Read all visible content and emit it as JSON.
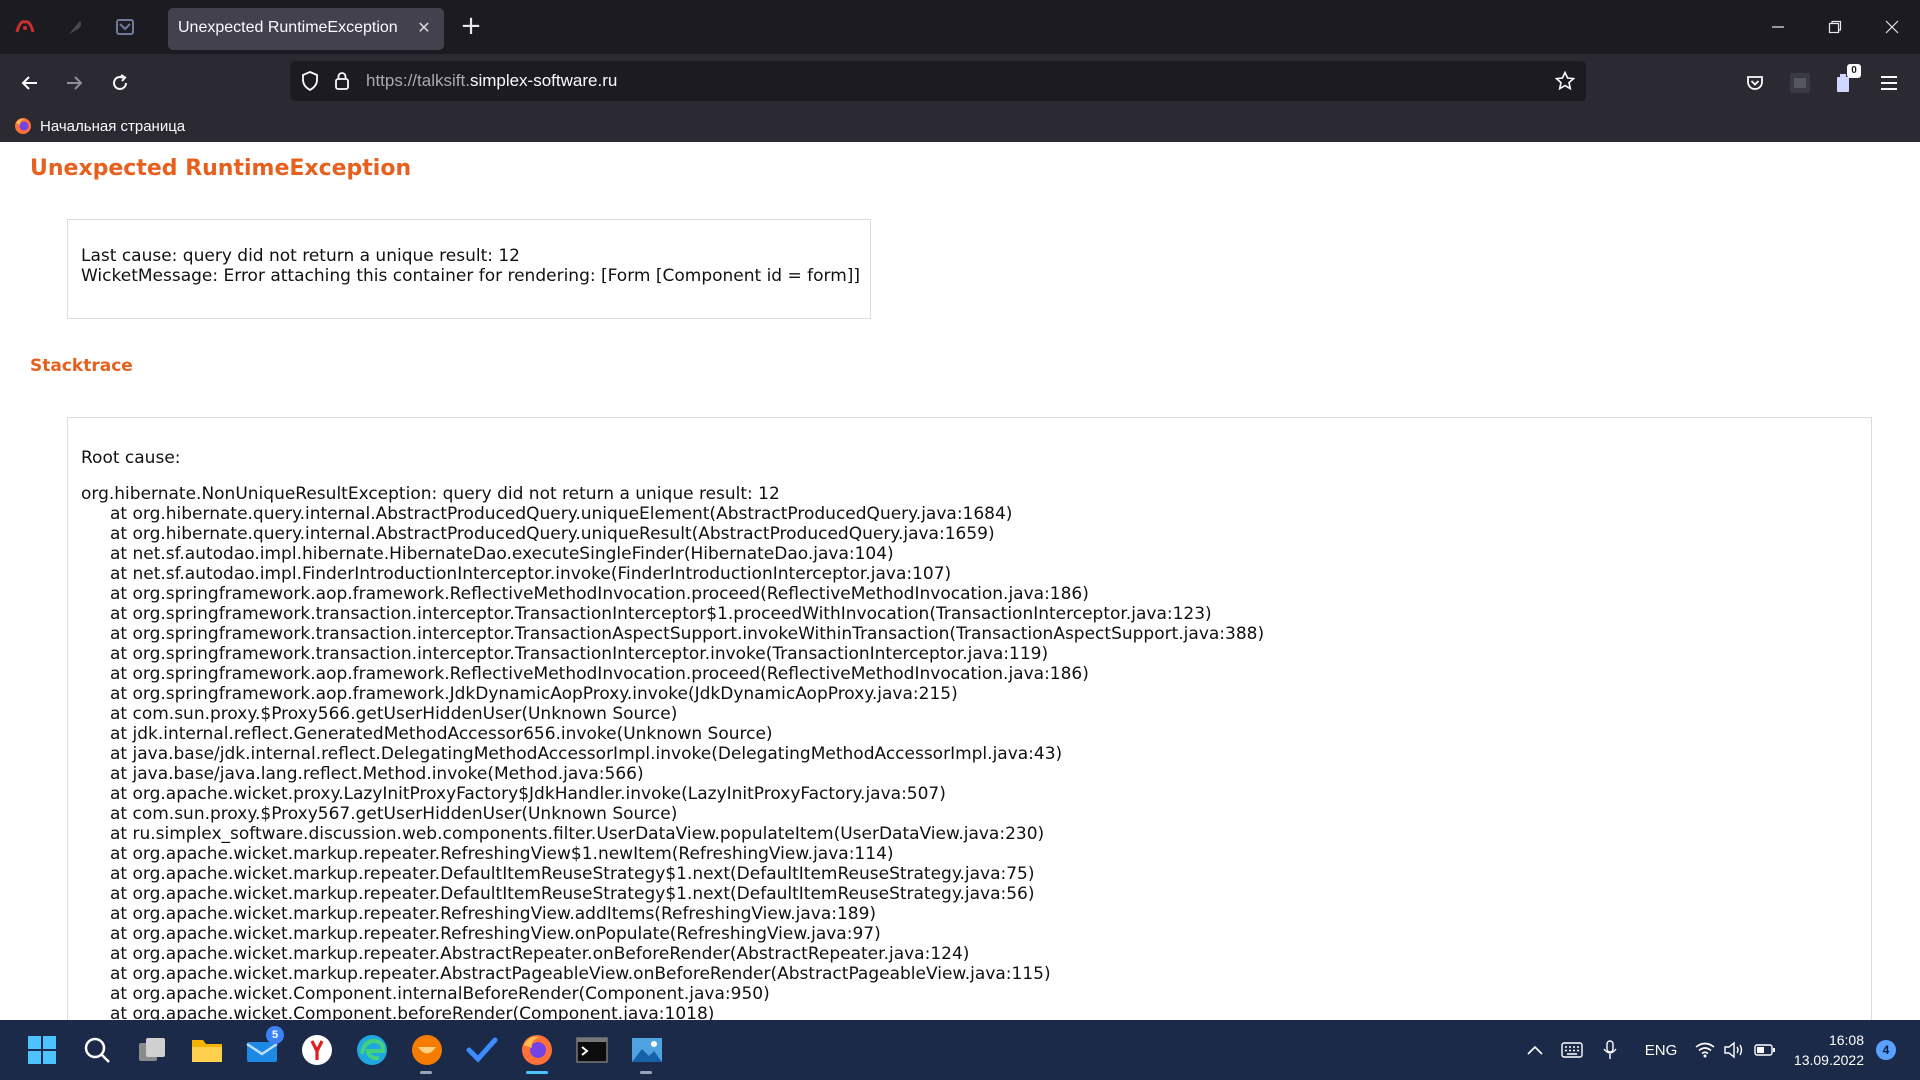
{
  "browser": {
    "tab": {
      "title": "Unexpected RuntimeException"
    },
    "url": {
      "scheme_subdomain": "https://talksift.",
      "domain": "simplex-software.ru"
    },
    "bookmarks": [
      {
        "label": "Начальная страница"
      }
    ],
    "extensions_badge": "0"
  },
  "page": {
    "title": "Unexpected RuntimeException",
    "cause_lines": [
      "Last cause: query did not return a unique result: 12",
      "WicketMessage: Error attaching this container for rendering: [Form [Component id = form]]"
    ],
    "stacktrace_heading": "Stacktrace",
    "root_cause_label": "Root cause:",
    "exception": "org.hibernate.NonUniqueResultException: query did not return a unique result: 12",
    "frames": [
      "at org.hibernate.query.internal.AbstractProducedQuery.uniqueElement(AbstractProducedQuery.java:1684)",
      "at org.hibernate.query.internal.AbstractProducedQuery.uniqueResult(AbstractProducedQuery.java:1659)",
      "at net.sf.autodao.impl.hibernate.HibernateDao.executeSingleFinder(HibernateDao.java:104)",
      "at net.sf.autodao.impl.FinderIntroductionInterceptor.invoke(FinderIntroductionInterceptor.java:107)",
      "at org.springframework.aop.framework.ReflectiveMethodInvocation.proceed(ReflectiveMethodInvocation.java:186)",
      "at org.springframework.transaction.interceptor.TransactionInterceptor$1.proceedWithInvocation(TransactionInterceptor.java:123)",
      "at org.springframework.transaction.interceptor.TransactionAspectSupport.invokeWithinTransaction(TransactionAspectSupport.java:388)",
      "at org.springframework.transaction.interceptor.TransactionInterceptor.invoke(TransactionInterceptor.java:119)",
      "at org.springframework.aop.framework.ReflectiveMethodInvocation.proceed(ReflectiveMethodInvocation.java:186)",
      "at org.springframework.aop.framework.JdkDynamicAopProxy.invoke(JdkDynamicAopProxy.java:215)",
      "at com.sun.proxy.$Proxy566.getUserHiddenUser(Unknown Source)",
      "at jdk.internal.reflect.GeneratedMethodAccessor656.invoke(Unknown Source)",
      "at java.base/jdk.internal.reflect.DelegatingMethodAccessorImpl.invoke(DelegatingMethodAccessorImpl.java:43)",
      "at java.base/java.lang.reflect.Method.invoke(Method.java:566)",
      "at org.apache.wicket.proxy.LazyInitProxyFactory$JdkHandler.invoke(LazyInitProxyFactory.java:507)",
      "at com.sun.proxy.$Proxy567.getUserHiddenUser(Unknown Source)",
      "at ru.simplex_software.discussion.web.components.filter.UserDataView.populateItem(UserDataView.java:230)",
      "at org.apache.wicket.markup.repeater.RefreshingView$1.newItem(RefreshingView.java:114)",
      "at org.apache.wicket.markup.repeater.DefaultItemReuseStrategy$1.next(DefaultItemReuseStrategy.java:75)",
      "at org.apache.wicket.markup.repeater.DefaultItemReuseStrategy$1.next(DefaultItemReuseStrategy.java:56)",
      "at org.apache.wicket.markup.repeater.RefreshingView.addItems(RefreshingView.java:189)",
      "at org.apache.wicket.markup.repeater.RefreshingView.onPopulate(RefreshingView.java:97)",
      "at org.apache.wicket.markup.repeater.AbstractRepeater.onBeforeRender(AbstractRepeater.java:124)",
      "at org.apache.wicket.markup.repeater.AbstractPageableView.onBeforeRender(AbstractPageableView.java:115)",
      "at org.apache.wicket.Component.internalBeforeRender(Component.java:950)",
      "at org.apache.wicket.Component.beforeRender(Component.java:1018)"
    ]
  },
  "taskbar": {
    "mail_badge": "5",
    "language": "ENG",
    "time": "16:08",
    "date": "13.09.2022",
    "notifications": "4"
  },
  "colors": {
    "accent_orange": "#e8601e",
    "chrome_dark": "#1c1b22",
    "chrome_mid": "#2b2a33",
    "taskbar": "#1b2a48"
  }
}
